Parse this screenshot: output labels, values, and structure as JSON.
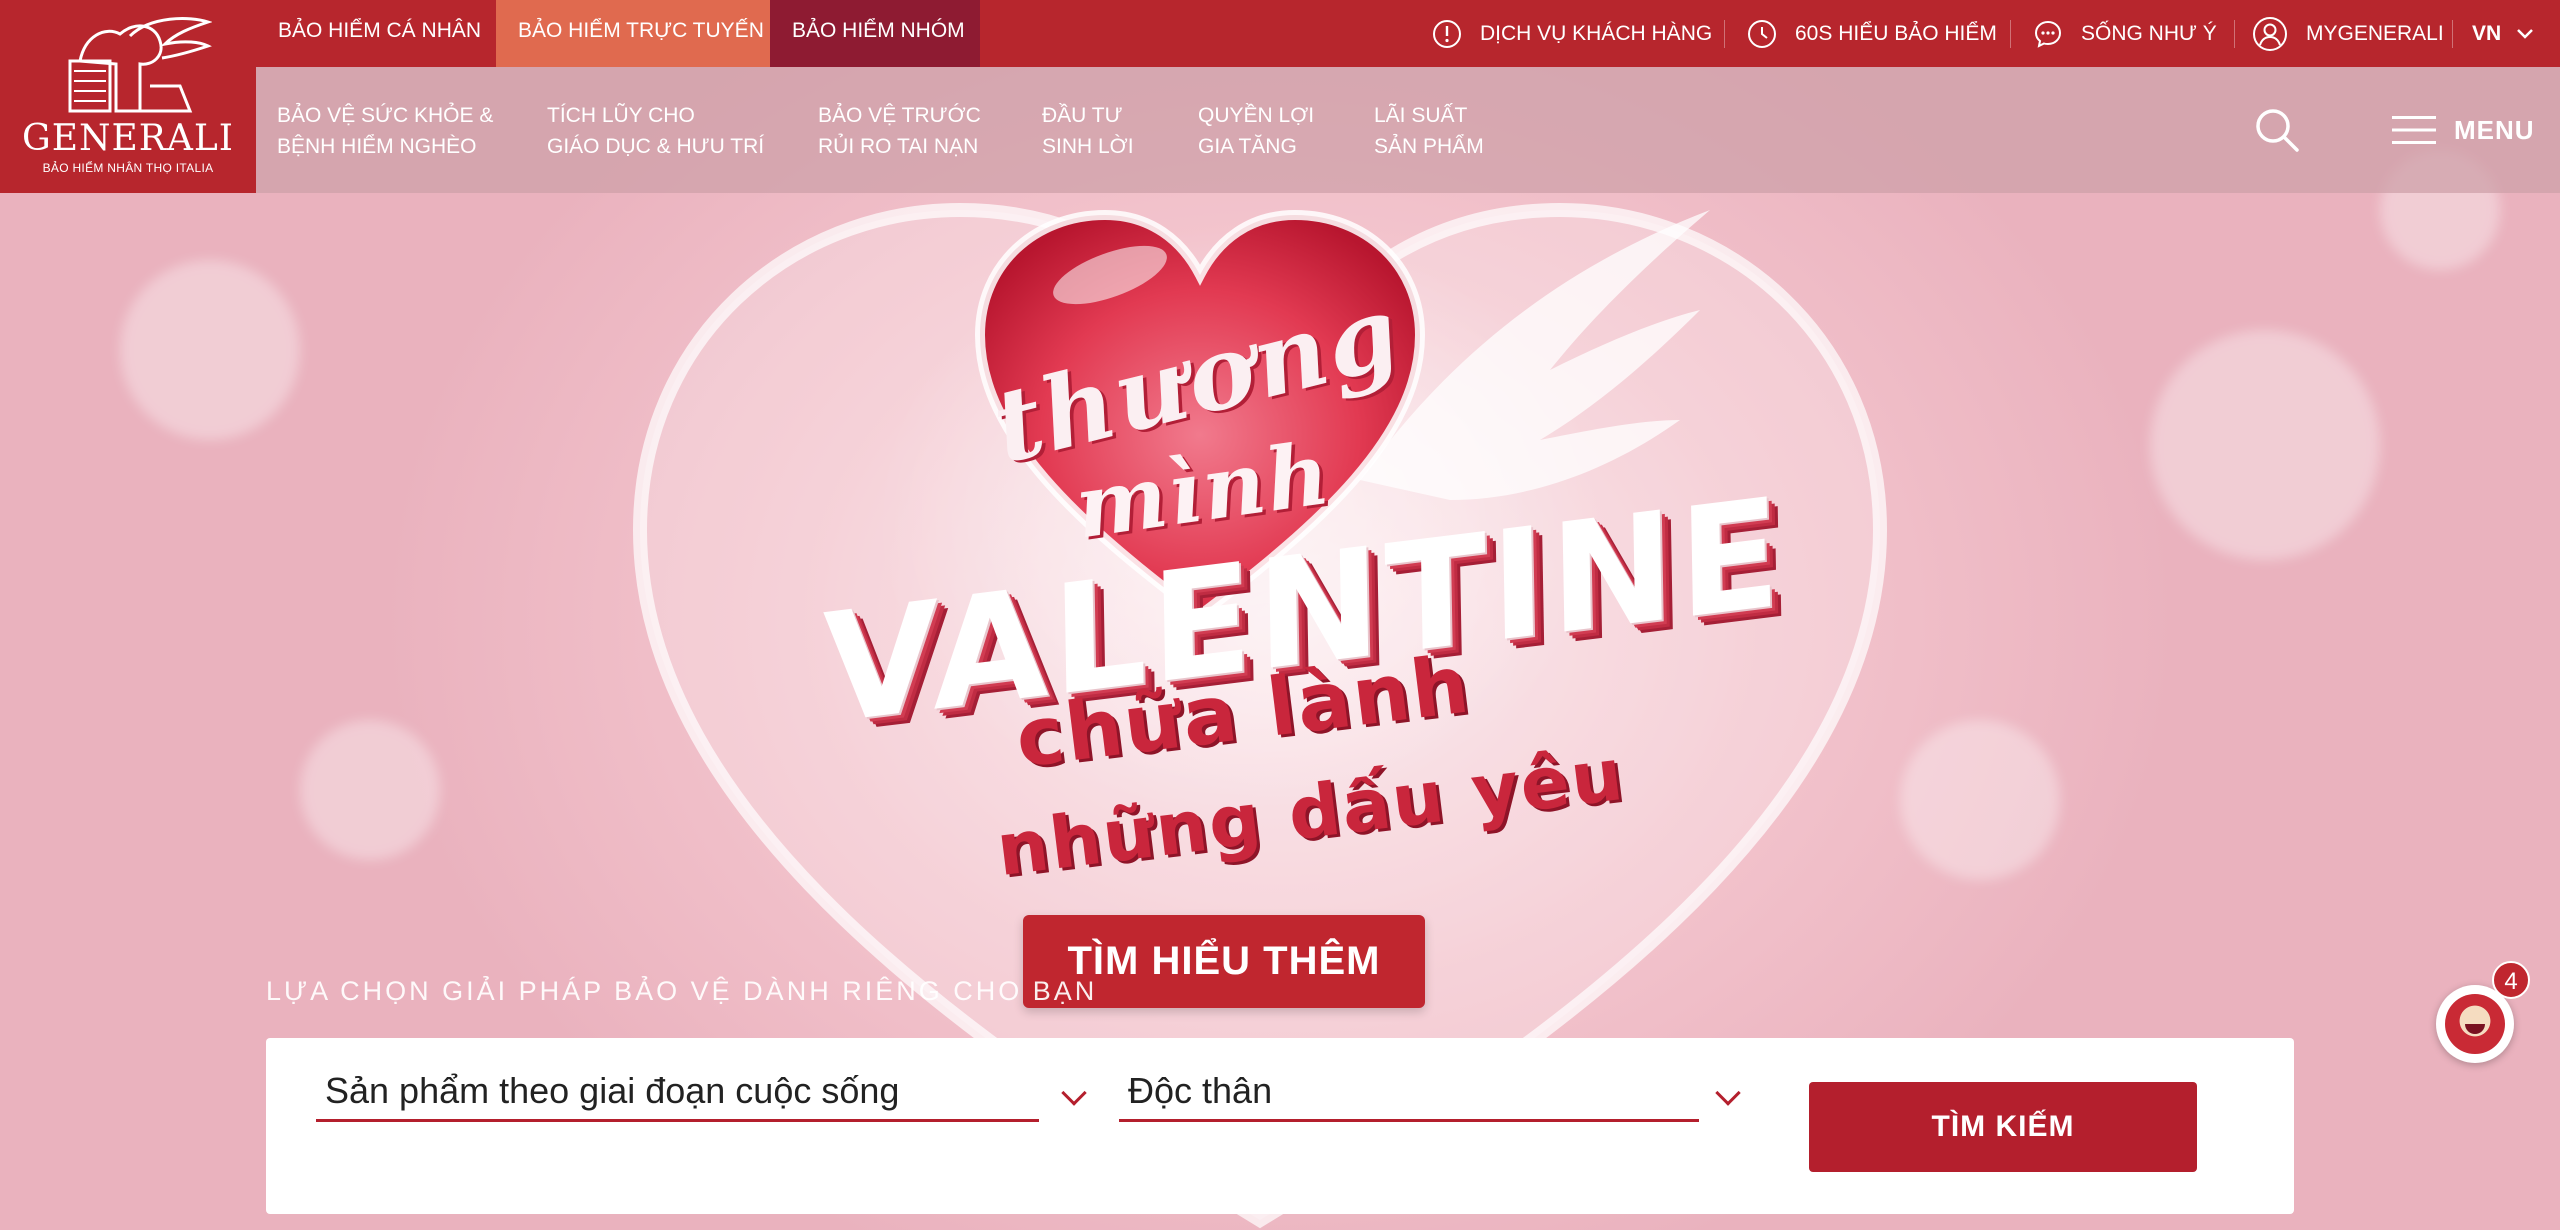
{
  "brand": {
    "name": "GENERALI",
    "subtitle": "BẢO HIỂM NHÂN THỌ ITALIA",
    "primary_color": "#b7262d",
    "accent_color": "#e06a4f",
    "dark_accent": "#8e1b32"
  },
  "top_tabs": [
    {
      "label": "BẢO HIỂM CÁ NHÂN"
    },
    {
      "label": "BẢO HIỂM TRỰC TUYẾN"
    },
    {
      "label": "BẢO HIỂM NHÓM"
    }
  ],
  "utility_links": [
    {
      "label": "DỊCH VỤ KHÁCH HÀNG",
      "icon": "info-circle-icon"
    },
    {
      "label": "60S HIỂU BẢO HIỂM",
      "icon": "clock-icon"
    },
    {
      "label": "SỐNG NHƯ Ý",
      "icon": "chat-bubble-icon"
    },
    {
      "label": "MYGENERALI",
      "icon": "user-circle-icon"
    }
  ],
  "language": {
    "label": "VN",
    "icon": "chevron-down-icon"
  },
  "nav_items": [
    {
      "line1": "BẢO VỆ SỨC KHỎE &",
      "line2": "BỆNH HIỂM NGHÈO"
    },
    {
      "line1": "TÍCH LŨY CHO",
      "line2": "GIÁO DỤC & HƯU TRÍ"
    },
    {
      "line1": "BẢO VỆ TRƯỚC",
      "line2": "RỦI RO TAI NẠN"
    },
    {
      "line1": "ĐẦU TƯ",
      "line2": "SINH LỜI"
    },
    {
      "line1": "QUYỀN LỢI",
      "line2": "GIA TĂNG"
    },
    {
      "line1": "LÃI SUẤT",
      "line2": "SẢN PHẨM"
    }
  ],
  "menu": {
    "label": "MENU",
    "icon": "hamburger-icon"
  },
  "hero": {
    "line_thuong": "thương",
    "line_minh": "mình",
    "line_valentine": "VALENTINE",
    "line_chua_lanh": "chữa lành",
    "line_nhung_dau_yeu": "những dấu yêu",
    "cta_label": "TÌM HIỂU THÊM"
  },
  "search": {
    "tagline": "LỰA CHỌN GIẢI PHÁP BẢO VỆ DÀNH RIÊNG CHO BẠN",
    "life_stage_value": "Sản phẩm theo giai đoạn cuộc sống",
    "status_value": "Độc thân",
    "button_label": "TÌM KIẾM"
  },
  "chat": {
    "badge_count": "4"
  }
}
